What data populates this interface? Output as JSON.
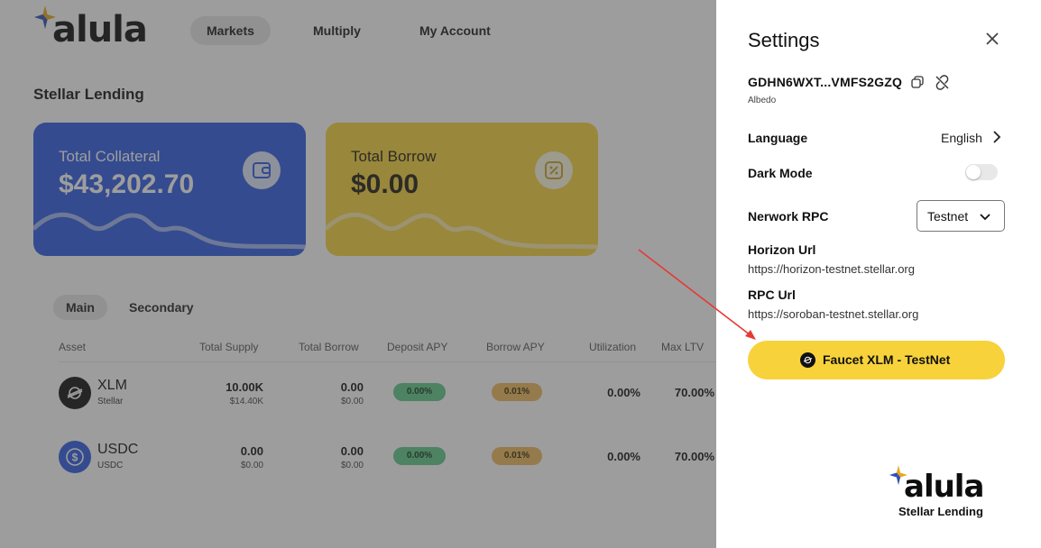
{
  "app": {
    "logo_text": "alula",
    "nav": [
      "Markets",
      "Multiply",
      "My Account"
    ],
    "page_title": "Stellar Lending",
    "cards": {
      "collateral": {
        "label": "Total Collateral",
        "value": "$43,202.70"
      },
      "borrow": {
        "label": "Total Borrow",
        "value": "$0.00"
      }
    },
    "tabs": [
      "Main",
      "Secondary"
    ],
    "table": {
      "headers": [
        "Asset",
        "Total Supply",
        "Total Borrow",
        "Deposit APY",
        "Borrow APY",
        "Utilization",
        "Max LTV"
      ],
      "rows": [
        {
          "symbol": "XLM",
          "name": "Stellar",
          "supply": "10.00K",
          "supply_usd": "$14.40K",
          "borrow": "0.00",
          "borrow_usd": "$0.00",
          "deposit_apy": "0.00%",
          "borrow_apy": "0.01%",
          "utilization": "0.00%",
          "max_ltv": "70.00%"
        },
        {
          "symbol": "USDC",
          "name": "USDC",
          "supply": "0.00",
          "supply_usd": "$0.00",
          "borrow": "0.00",
          "borrow_usd": "$0.00",
          "deposit_apy": "0.00%",
          "borrow_apy": "0.01%",
          "utilization": "0.00%",
          "max_ltv": "70.00%"
        }
      ]
    }
  },
  "settings": {
    "title": "Settings",
    "address": "GDHN6WXT...VMFS2GZQ",
    "wallet": "Albedo",
    "language_label": "Language",
    "language_value": "English",
    "dark_mode_label": "Dark Mode",
    "dark_mode_on": false,
    "rpc_label": "Nerwork RPC",
    "rpc_value": "Testnet",
    "horizon_label": "Horizon Url",
    "horizon_url": "https://horizon-testnet.stellar.org",
    "rpc_url_label": "RPC Url",
    "rpc_url": "https://soroban-testnet.stellar.org",
    "faucet_label": "Faucet XLM - TestNet"
  },
  "brand": {
    "logo_text": "alula",
    "tagline": "Stellar Lending"
  },
  "colors": {
    "accent_yellow": "#f7d23a",
    "card_blue": "#2d5be3",
    "pill_green": "#5fc98a",
    "pill_tan": "#efb85a",
    "arrow_red": "#e53935"
  }
}
